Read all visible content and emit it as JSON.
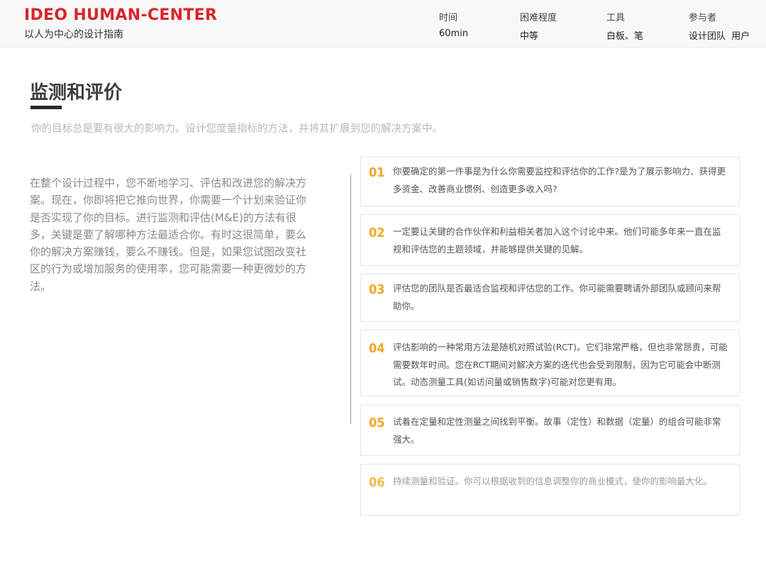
{
  "header": {
    "brand": "IDEO HUMAN-CENTER",
    "subtitle": "以人为中心的设计指南",
    "meta": [
      {
        "key": "时间",
        "value": "60min"
      },
      {
        "key": "困难程度",
        "value": "中等"
      },
      {
        "key": "工具",
        "value": "白板、笔"
      },
      {
        "key": "参与者",
        "value": "设计团队  用户"
      }
    ]
  },
  "section": {
    "title": "监测和评价",
    "subtitle": "你的目标总是要有很大的影响力。设计您度量指标的方法，并将其扩展到您的解决方案中。",
    "intro": "在整个设计过程中，您不断地学习、评估和改进您的解决方案。现在，你即将把它推向世界，你需要一个计划来验证你是否实现了你的目标。进行监测和评估(M&E)的方法有很多，关键是要了解哪种方法最适合你。有时这很简单，要么你的解决方案赚钱，要么不赚钱。但是，如果您试图改变社区的行为或增加服务的使用率，您可能需要一种更微妙的方法。"
  },
  "steps": [
    {
      "num": "01",
      "text": "你要确定的第一件事是为什么你需要监控和评估你的工作?是为了展示影响力、获得更多资金、改善商业惯例、创造更多收入吗?"
    },
    {
      "num": "02",
      "text": "一定要让关键的合作伙伴和利益相关者加入这个讨论中来。他们可能多年来一直在监视和评估您的主题领域，并能够提供关键的见解。"
    },
    {
      "num": "03",
      "text": "评估您的团队是否最适合监视和评估您的工作。你可能需要聘请外部团队或顾问来帮助你。"
    },
    {
      "num": "04",
      "text": "评估影响的一种常用方法是随机对照试验(RCT)。它们非常严格，但也非常昂贵，可能需要数年时间。您在RCT期间对解决方案的迭代也会受到限制，因为它可能会中断测试。动态测量工具(如访问量或销售数字)可能对您更有用。"
    },
    {
      "num": "05",
      "text": "试着在定量和定性测量之间找到平衡。故事（定性）和数据（定量）的组合可能非常强大。"
    },
    {
      "num": "06",
      "text": "持续测量和验证。你可以根据收到的信息调整你的商业模式，使你的影响最大化。"
    }
  ]
}
